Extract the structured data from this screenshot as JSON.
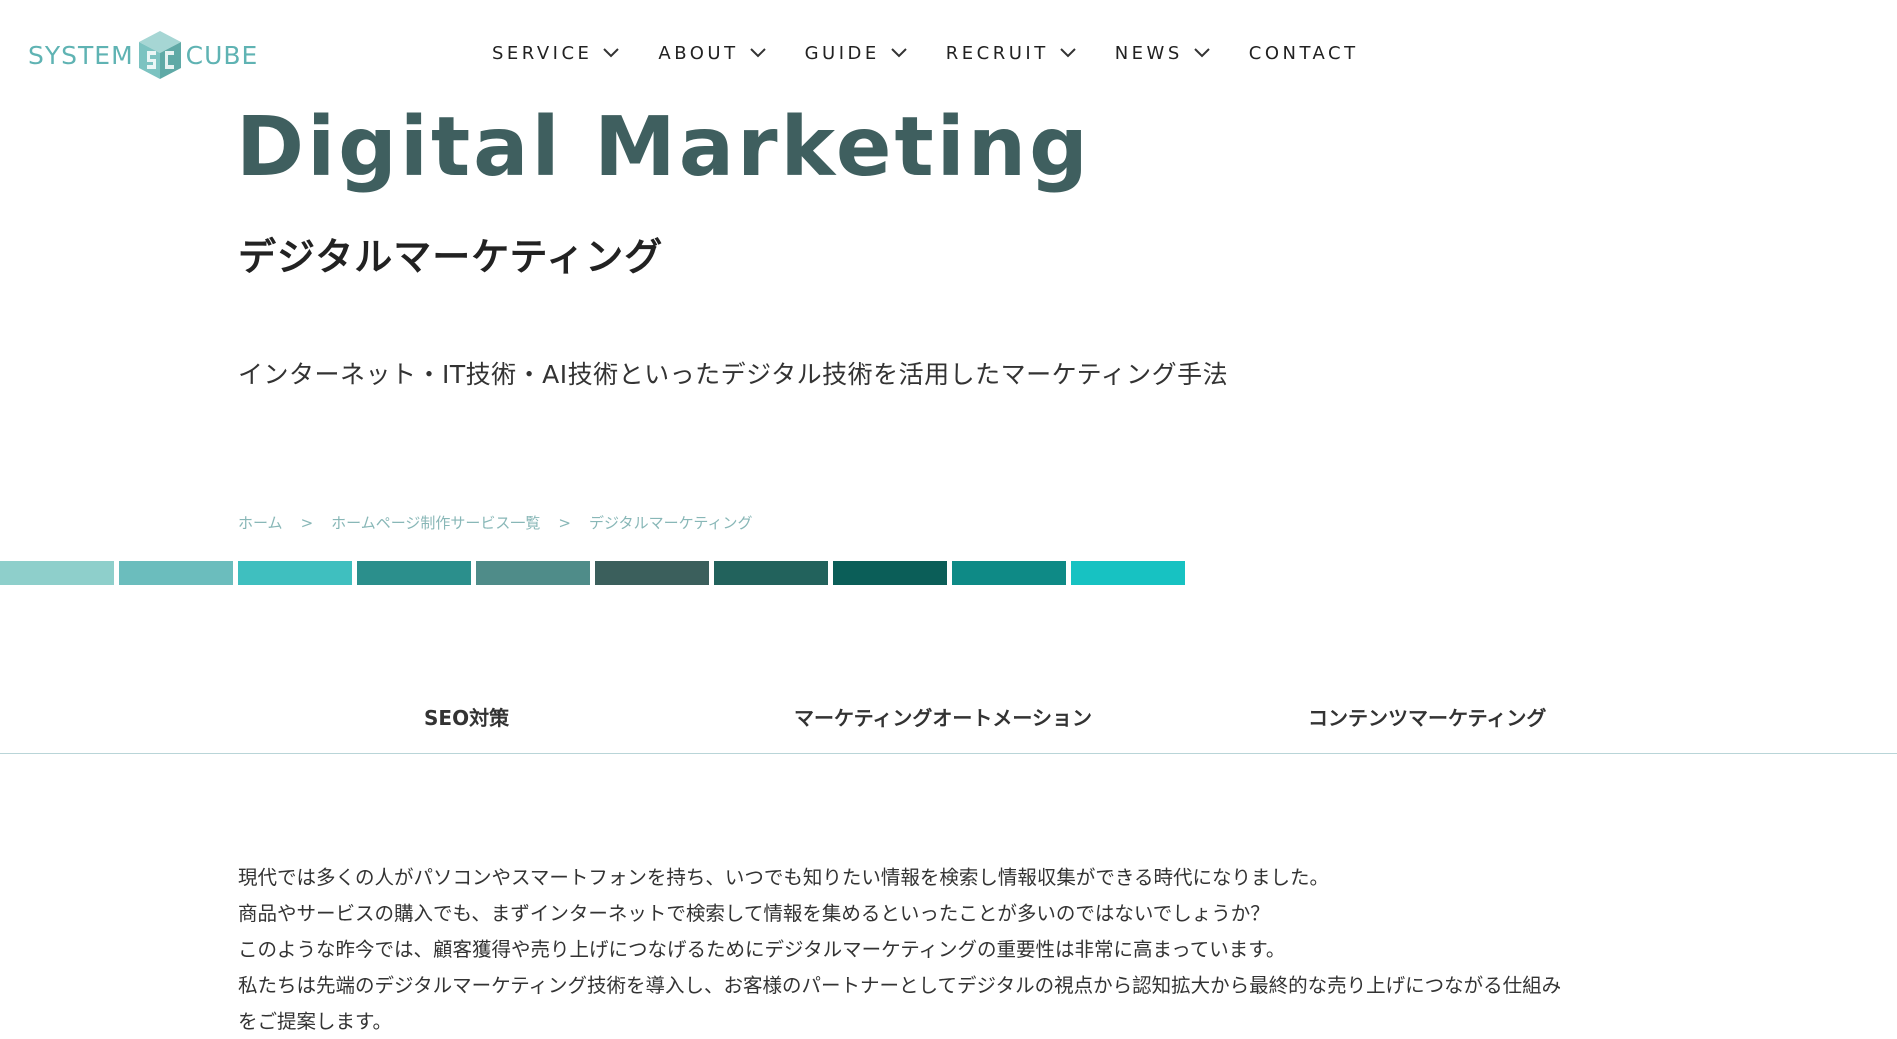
{
  "header": {
    "logo": {
      "left_text": "SYSTEM",
      "right_text": "CUBE",
      "icon": "cube-logo-icon",
      "color": "#5fb3b3"
    },
    "nav": [
      {
        "label": "SERVICE",
        "has_dropdown": true
      },
      {
        "label": "ABOUT",
        "has_dropdown": true
      },
      {
        "label": "GUIDE",
        "has_dropdown": true
      },
      {
        "label": "RECRUIT",
        "has_dropdown": true
      },
      {
        "label": "NEWS",
        "has_dropdown": true
      },
      {
        "label": "CONTACT",
        "has_dropdown": false
      }
    ]
  },
  "hero": {
    "title": "Digital Marketing",
    "subtitle": "デジタルマーケティング",
    "description": "インターネット・IT技術・AI技術といったデジタル技術を活用したマーケティング手法",
    "title_color": "#3f5f5f"
  },
  "breadcrumb": {
    "items": [
      "ホーム",
      "ホームページ制作サービス一覧",
      "デジタルマーケティング"
    ],
    "separator": ">"
  },
  "colorbar": {
    "colors": [
      "#8ecfcb",
      "#6bbdbd",
      "#3fbfbf",
      "#2b8f8c",
      "#4f8c89",
      "#3b5f5c",
      "#22625c",
      "#0b5e58",
      "#0e8a86",
      "#17c2c2"
    ]
  },
  "tabs": [
    "SEO対策",
    "マーケティングオートメーション",
    "コンテンツマーケティング"
  ],
  "body": {
    "lines": [
      "現代では多くの人がパソコンやスマートフォンを持ち、いつでも知りたい情報を検索し情報収集ができる時代になりました。",
      "商品やサービスの購入でも、まずインターネットで検索して情報を集めるといったことが多いのではないでしょうか？",
      "このような昨今では、顧客獲得や売り上げにつなげるためにデジタルマーケティングの重要性は非常に高まっています。",
      "私たちは先端のデジタルマーケティング技術を導入し、お客様のパートナーとしてデジタルの視点から認知拡大から最終的な売り上げにつながる仕組み",
      "をご提案します。"
    ]
  }
}
